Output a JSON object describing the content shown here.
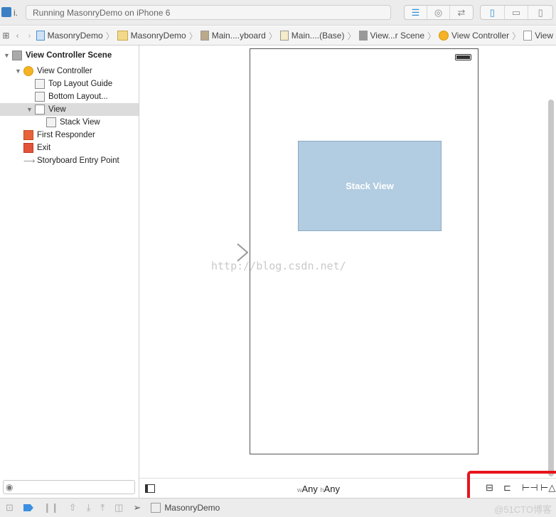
{
  "toolbar": {
    "scheme_label": "i.",
    "status": "Running MasonryDemo on iPhone 6"
  },
  "breadcrumb": [
    "MasonryDemo",
    "MasonryDemo",
    "Main....yboard",
    "Main....(Base)",
    "View...r Scene",
    "View Controller",
    "View"
  ],
  "outline": [
    {
      "label": "View Controller Scene",
      "icon": "scene-icon"
    },
    {
      "label": "View Controller",
      "icon": "view-controller-icon"
    },
    {
      "label": "Top Layout Guide",
      "icon": "top-layout-guide-icon"
    },
    {
      "label": "Bottom Layout...",
      "icon": "bottom-layout-guide-icon"
    },
    {
      "label": "View",
      "icon": "view-icon",
      "selected": true
    },
    {
      "label": "Stack View",
      "icon": "stack-view-icon"
    },
    {
      "label": "First Responder",
      "icon": "first-responder-icon"
    },
    {
      "label": "Exit",
      "icon": "exit-icon"
    },
    {
      "label": "Storyboard Entry Point",
      "icon": "entry-point-arrow-icon"
    }
  ],
  "canvas": {
    "stack_view_label": "Stack View",
    "watermark": "http://blog.csdn.net/",
    "stack_color": "#b2cce1"
  },
  "size_class": {
    "w_prefix": "w",
    "w_value": "Any",
    "h_prefix": "h",
    "h_value": "Any"
  },
  "debug": {
    "target": "MasonryDemo",
    "corner_watermark": "@51CTO博客"
  },
  "highlight_color": "#e8141c"
}
